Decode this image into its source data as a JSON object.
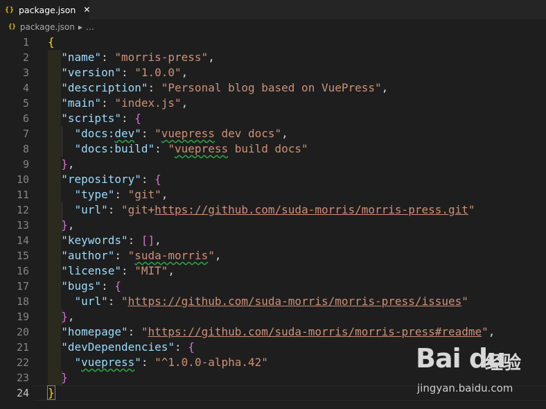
{
  "tab": {
    "icon": "{}",
    "label": "package.json",
    "close": "✕"
  },
  "breadcrumb": {
    "icon": "{}",
    "file": "package.json",
    "separator": "▶",
    "more": "…"
  },
  "editor": {
    "line_numbers": [
      "1",
      "2",
      "3",
      "4",
      "5",
      "6",
      "7",
      "8",
      "9",
      "10",
      "11",
      "12",
      "13",
      "14",
      "15",
      "16",
      "17",
      "18",
      "19",
      "20",
      "21",
      "22",
      "23",
      "24"
    ],
    "lines": [
      [
        {
          "t": "{",
          "c": "b1"
        }
      ],
      [
        {
          "t": "  "
        },
        {
          "t": "\"name\"",
          "c": "k"
        },
        {
          "t": ": "
        },
        {
          "t": "\"morris-press\"",
          "c": "s"
        },
        {
          "t": ","
        }
      ],
      [
        {
          "t": "  "
        },
        {
          "t": "\"version\"",
          "c": "k"
        },
        {
          "t": ": "
        },
        {
          "t": "\"1.0.0\"",
          "c": "s"
        },
        {
          "t": ","
        }
      ],
      [
        {
          "t": "  "
        },
        {
          "t": "\"description\"",
          "c": "k"
        },
        {
          "t": ": "
        },
        {
          "t": "\"Personal blog based on VuePress\"",
          "c": "s"
        },
        {
          "t": ","
        }
      ],
      [
        {
          "t": "  "
        },
        {
          "t": "\"main\"",
          "c": "k"
        },
        {
          "t": ": "
        },
        {
          "t": "\"index.js\"",
          "c": "s"
        },
        {
          "t": ","
        }
      ],
      [
        {
          "t": "  "
        },
        {
          "t": "\"scripts\"",
          "c": "k"
        },
        {
          "t": ": "
        },
        {
          "t": "{",
          "c": "b2"
        }
      ],
      [
        {
          "t": "    "
        },
        {
          "t": "\"docs:",
          "c": "k"
        },
        {
          "t": "dev",
          "c": "k sq"
        },
        {
          "t": "\"",
          "c": "k"
        },
        {
          "t": ": "
        },
        {
          "t": "\"",
          "c": "s"
        },
        {
          "t": "vuepress",
          "c": "s sq"
        },
        {
          "t": " dev docs\"",
          "c": "s"
        },
        {
          "t": ","
        }
      ],
      [
        {
          "t": "    "
        },
        {
          "t": "\"docs:build\"",
          "c": "k"
        },
        {
          "t": ": "
        },
        {
          "t": "\"",
          "c": "s"
        },
        {
          "t": "vuepress",
          "c": "s sq"
        },
        {
          "t": " build docs\"",
          "c": "s"
        }
      ],
      [
        {
          "t": "  "
        },
        {
          "t": "}",
          "c": "b2"
        },
        {
          "t": ","
        }
      ],
      [
        {
          "t": "  "
        },
        {
          "t": "\"repository\"",
          "c": "k"
        },
        {
          "t": ": "
        },
        {
          "t": "{",
          "c": "b2"
        }
      ],
      [
        {
          "t": "    "
        },
        {
          "t": "\"type\"",
          "c": "k"
        },
        {
          "t": ": "
        },
        {
          "t": "\"git\"",
          "c": "s"
        },
        {
          "t": ","
        }
      ],
      [
        {
          "t": "    "
        },
        {
          "t": "\"url\"",
          "c": "k"
        },
        {
          "t": ": "
        },
        {
          "t": "\"git+",
          "c": "s"
        },
        {
          "t": "https://github.com/suda-morris/morris-press.git",
          "c": "s u"
        },
        {
          "t": "\"",
          "c": "s"
        }
      ],
      [
        {
          "t": "  "
        },
        {
          "t": "}",
          "c": "b2"
        },
        {
          "t": ","
        }
      ],
      [
        {
          "t": "  "
        },
        {
          "t": "\"keywords\"",
          "c": "k"
        },
        {
          "t": ": "
        },
        {
          "t": "[]",
          "c": "b2"
        },
        {
          "t": ","
        }
      ],
      [
        {
          "t": "  "
        },
        {
          "t": "\"author\"",
          "c": "k"
        },
        {
          "t": ": "
        },
        {
          "t": "\"",
          "c": "s"
        },
        {
          "t": "suda-morris",
          "c": "s sq"
        },
        {
          "t": "\"",
          "c": "s"
        },
        {
          "t": ","
        }
      ],
      [
        {
          "t": "  "
        },
        {
          "t": "\"license\"",
          "c": "k"
        },
        {
          "t": ": "
        },
        {
          "t": "\"MIT\"",
          "c": "s"
        },
        {
          "t": ","
        }
      ],
      [
        {
          "t": "  "
        },
        {
          "t": "\"bugs\"",
          "c": "k"
        },
        {
          "t": ": "
        },
        {
          "t": "{",
          "c": "b2"
        }
      ],
      [
        {
          "t": "    "
        },
        {
          "t": "\"url\"",
          "c": "k"
        },
        {
          "t": ": "
        },
        {
          "t": "\"",
          "c": "s"
        },
        {
          "t": "https://github.com/suda-morris/morris-press/issues",
          "c": "s u"
        },
        {
          "t": "\"",
          "c": "s"
        }
      ],
      [
        {
          "t": "  "
        },
        {
          "t": "}",
          "c": "b2"
        },
        {
          "t": ","
        }
      ],
      [
        {
          "t": "  "
        },
        {
          "t": "\"homepage\"",
          "c": "k"
        },
        {
          "t": ": "
        },
        {
          "t": "\"",
          "c": "s"
        },
        {
          "t": "https://github.com/suda-morris/morris-press#readme",
          "c": "s u"
        },
        {
          "t": "\"",
          "c": "s"
        },
        {
          "t": ","
        }
      ],
      [
        {
          "t": "  "
        },
        {
          "t": "\"devDependencies\"",
          "c": "k"
        },
        {
          "t": ": "
        },
        {
          "t": "{",
          "c": "b2"
        }
      ],
      [
        {
          "t": "    "
        },
        {
          "t": "\"",
          "c": "k"
        },
        {
          "t": "vuepress",
          "c": "k sq"
        },
        {
          "t": "\"",
          "c": "k"
        },
        {
          "t": ": "
        },
        {
          "t": "\"^1.0.0-alpha.42\"",
          "c": "s"
        }
      ],
      [
        {
          "t": "  "
        },
        {
          "t": "}",
          "c": "b2"
        }
      ],
      [
        {
          "t": "}",
          "c": "b1 bracketbox"
        }
      ]
    ],
    "active_line": "24"
  },
  "watermark": {
    "logo": "Bai du",
    "cn": "经验",
    "url": "jingyan.baidu.com"
  },
  "colors": {
    "bg": "#1e1e1e",
    "key": "#9cdcfe",
    "string": "#ce9178",
    "brace": "#ffd700",
    "nested_brace": "#da70d6"
  }
}
